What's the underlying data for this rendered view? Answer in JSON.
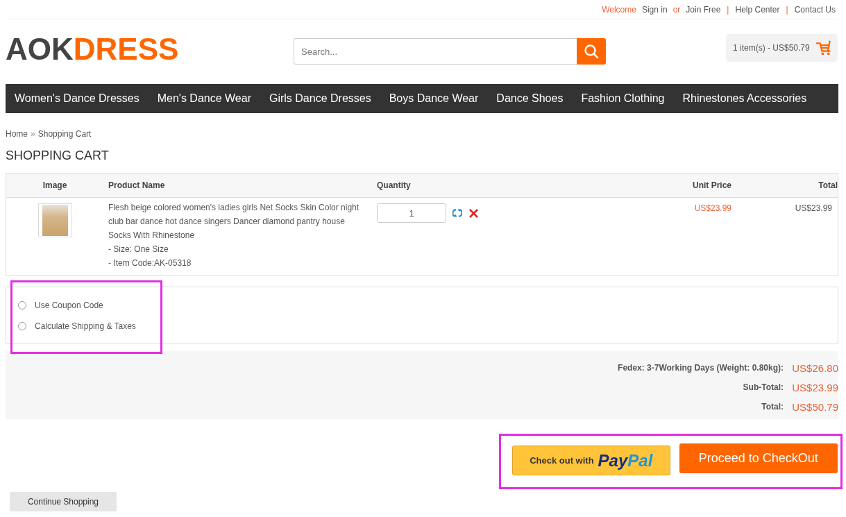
{
  "top_links": [
    {
      "text": "Welcome",
      "kind": "accent"
    },
    {
      "text": "Sign in",
      "kind": "link"
    },
    {
      "text": "or",
      "kind": "accent"
    },
    {
      "text": "Join Free",
      "kind": "link"
    },
    {
      "text": "|",
      "kind": "separator"
    },
    {
      "text": "Help Center",
      "kind": "link"
    },
    {
      "text": "|",
      "kind": "separator"
    },
    {
      "text": "Contact Us",
      "kind": "link"
    }
  ],
  "logo": {
    "dark": "AOK",
    "accent": "DRESS"
  },
  "search": {
    "placeholder": "Search..."
  },
  "mini_cart": {
    "text": "1 item(s) - US$50.79"
  },
  "nav": [
    "Women's Dance Dresses",
    "Men's Dance Wear",
    "Girls Dance Dresses",
    "Boys Dance Wear",
    "Dance Shoes",
    "Fashion Clothing",
    "Rhinestones Accessories"
  ],
  "breadcrumb": {
    "items": [
      "Home",
      "Shopping Cart"
    ],
    "separator": "»"
  },
  "page_title": "SHOPPING CART",
  "cart": {
    "columns": [
      "Image",
      "Product Name",
      "Quantity",
      "Unit Price",
      "Total"
    ],
    "rows": [
      {
        "name": "Flesh beige colored women's ladies girls Net Socks Skin Color night club bar dance hot dance singers Dancer diamond pantry house Socks With Rhinestone",
        "options": [
          "- Size: One Size",
          "- Item Code:AK-05318"
        ],
        "quantity": "1",
        "unit_price": "US$23.99",
        "total": "US$23.99"
      }
    ]
  },
  "options_panel": {
    "highlighted": true,
    "items": [
      {
        "label": "Use Coupon Code",
        "selected": false
      },
      {
        "label": "Calculate Shipping & Taxes",
        "selected": false
      }
    ]
  },
  "totals": [
    {
      "label": "Fedex: 3-7Working Days (Weight: 0.80kg):",
      "value": "US$26.80"
    },
    {
      "label": "Sub-Total:",
      "value": "US$23.99"
    },
    {
      "label": "Total:",
      "value": "US$50.79"
    }
  ],
  "checkout_actions": {
    "highlighted": true,
    "paypal": {
      "text": "Check out with",
      "brand_dark": "Pay",
      "brand_light": "Pal"
    },
    "checkout": "Proceed to CheckOut"
  },
  "continue_button": "Continue Shopping"
}
